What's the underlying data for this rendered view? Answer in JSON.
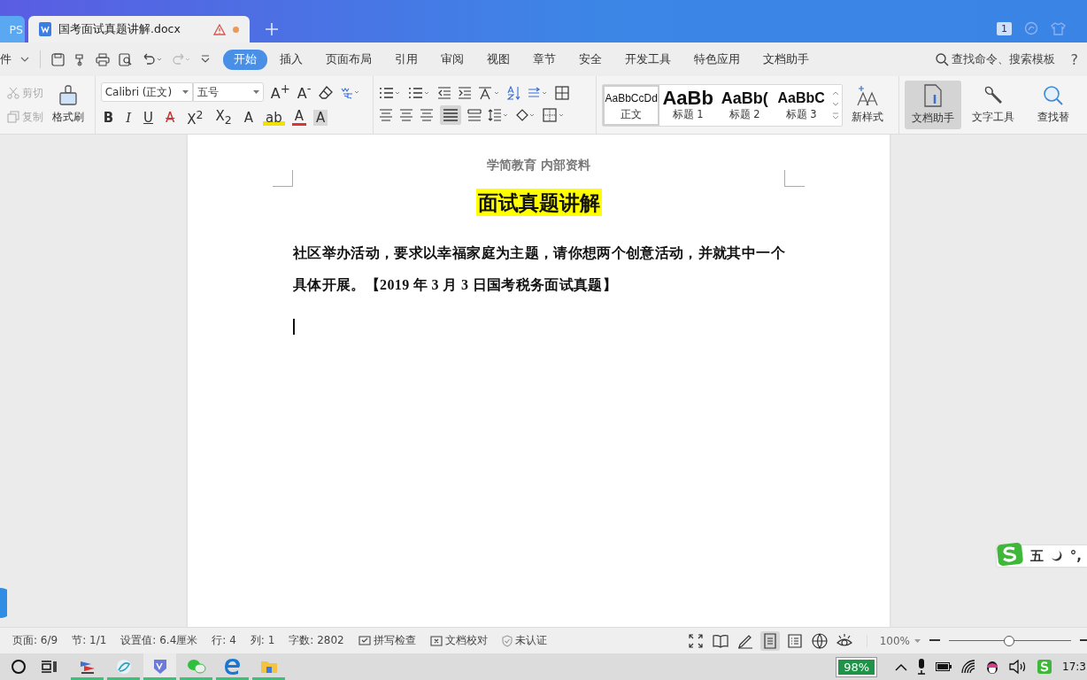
{
  "tabs": [
    {
      "label": "PS",
      "selected": false
    },
    {
      "label": "国考面试真题讲解.docx",
      "selected": true
    }
  ],
  "account_badge": "1",
  "menu": {
    "file": "件",
    "tabs": [
      {
        "label": "开始",
        "selected": true
      },
      {
        "label": "插入",
        "selected": false
      },
      {
        "label": "页面布局",
        "selected": false
      },
      {
        "label": "引用",
        "selected": false
      },
      {
        "label": "审阅",
        "selected": false
      },
      {
        "label": "视图",
        "selected": false
      },
      {
        "label": "章节",
        "selected": false
      },
      {
        "label": "安全",
        "selected": false
      },
      {
        "label": "开发工具",
        "selected": false
      },
      {
        "label": "特色应用",
        "selected": false
      },
      {
        "label": "文档助手",
        "selected": false
      }
    ],
    "search": "查找命令、搜索模板",
    "help": "?"
  },
  "ribbon": {
    "clipboard": [
      {
        "label": "剪切",
        "disabled": true
      },
      {
        "label": "复制",
        "disabled": true
      }
    ],
    "format_painter": "格式刷",
    "font": "Calibri (正文)",
    "size": "五号",
    "grow": "A$^{+}$",
    "shrink": "A$^{-}$",
    "format": [
      "B",
      "I",
      "U",
      "A",
      "X$^{2}$",
      "X$_{2}$",
      "A",
      "ab",
      "A",
      "A"
    ],
    "styles": [
      {
        "sample": "AaBbCcDd",
        "label": "正文",
        "kind": "body",
        "selected": true
      },
      {
        "sample": "AaBb",
        "label": "标题 1",
        "kind": "h1",
        "selected": false
      },
      {
        "sample": "AaBb(",
        "label": "标题 2",
        "kind": "h2",
        "selected": false
      },
      {
        "sample": "AaBbC",
        "label": "标题 3",
        "kind": "h3",
        "selected": false
      }
    ],
    "new_style": "新样式",
    "tools": [
      {
        "label": "文档助手",
        "pressed": true
      },
      {
        "label": "文字工具",
        "pressed": false
      },
      {
        "label": "查找替",
        "pressed": false
      }
    ]
  },
  "document": {
    "header": "学简教育  内部资料",
    "title": "面试真题讲解",
    "paragraph": "社区举办活动，要求以幸福家庭为主题，请你想两个创意活动，并就其中一个具体开展。【2019 年 3 月 3 日国考税务面试真题】"
  },
  "ime": {
    "mode": "五",
    "punct": "°,"
  },
  "status_bar": {
    "items": [
      {
        "text": "页面: 6/9"
      },
      {
        "text": "节: 1/1"
      },
      {
        "text": "设置值: 6.4厘米"
      },
      {
        "text": "行: 4"
      },
      {
        "text": "列: 1"
      },
      {
        "text": "字数: 2802"
      },
      {
        "text": "拼写检查",
        "kind": "spell"
      },
      {
        "text": "文档校对",
        "kind": "proof"
      },
      {
        "text": "未认证",
        "kind": "shield"
      }
    ],
    "views": [
      {
        "kind": "fullscreen",
        "selected": false
      },
      {
        "kind": "read",
        "selected": false
      },
      {
        "kind": "edit",
        "selected": false
      },
      {
        "kind": "page",
        "selected": true
      },
      {
        "kind": "outline",
        "selected": false
      },
      {
        "kind": "web",
        "selected": false
      },
      {
        "kind": "eye",
        "selected": false
      }
    ],
    "zoom": "100%",
    "zoom_slider": {
      "level": 0.49
    }
  },
  "taskbar": {
    "battery": "98%",
    "clock": "17:3"
  }
}
